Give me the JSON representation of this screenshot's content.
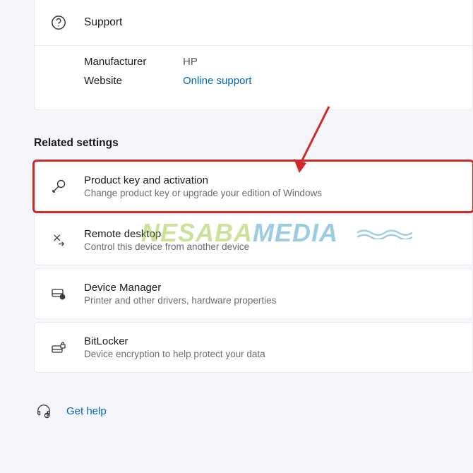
{
  "support": {
    "header_label": "Support",
    "manufacturer_label": "Manufacturer",
    "manufacturer_value": "HP",
    "website_label": "Website",
    "website_link": "Online support"
  },
  "related_heading": "Related settings",
  "settings": {
    "product_key": {
      "title": "Product key and activation",
      "subtitle": "Change product key or upgrade your edition of Windows"
    },
    "remote": {
      "title": "Remote desktop",
      "subtitle": "Control this device from another device"
    },
    "device_manager": {
      "title": "Device Manager",
      "subtitle": "Printer and other drivers, hardware properties"
    },
    "bitlocker": {
      "title": "BitLocker",
      "subtitle": "Device encryption to help protect your data"
    }
  },
  "get_help_label": "Get help",
  "watermark": {
    "part1": "NESABA",
    "part2": "MEDIA"
  },
  "colors": {
    "highlight": "#d22828",
    "link": "#0067c0"
  }
}
